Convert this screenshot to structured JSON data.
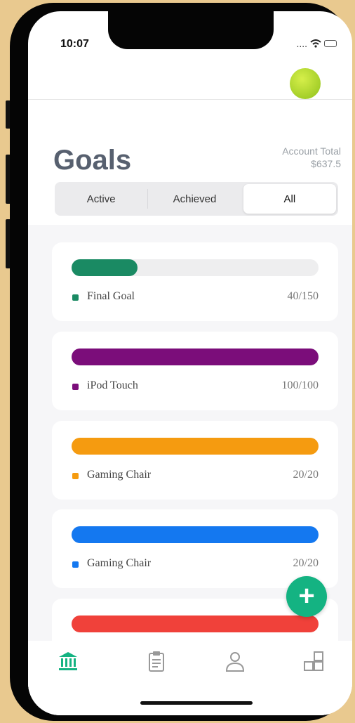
{
  "status": {
    "time": "10:07",
    "signal": "....",
    "wifi": "wifi-icon",
    "battery": "battery-icon"
  },
  "header": {
    "avatar": "avatar-icon"
  },
  "page": {
    "title": "Goals",
    "account_label": "Account Total",
    "account_value": "$637.5"
  },
  "segments": [
    {
      "label": "Active",
      "selected": false
    },
    {
      "label": "Achieved",
      "selected": false
    },
    {
      "label": "All",
      "selected": true
    }
  ],
  "goals": [
    {
      "name": "Final Goal",
      "progress": "40/150",
      "fraction": 0.267,
      "color": "#1a8a63"
    },
    {
      "name": "iPod Touch",
      "progress": "100/100",
      "fraction": 1.0,
      "color": "#7b0d7a"
    },
    {
      "name": "Gaming Chair",
      "progress": "20/20",
      "fraction": 1.0,
      "color": "#f59b10"
    },
    {
      "name": "Gaming Chair",
      "progress": "20/20",
      "fraction": 1.0,
      "color": "#1478f0"
    },
    {
      "name": "",
      "progress": "",
      "fraction": 1.0,
      "color": "#f0413a"
    }
  ],
  "fab": {
    "label": "+"
  },
  "tabs": [
    {
      "name": "bank-icon",
      "active": true
    },
    {
      "name": "clipboard-icon",
      "active": false
    },
    {
      "name": "person-icon",
      "active": false
    },
    {
      "name": "boxes-icon",
      "active": false
    }
  ],
  "colors": {
    "accent": "#14b382",
    "title": "#57606f"
  }
}
